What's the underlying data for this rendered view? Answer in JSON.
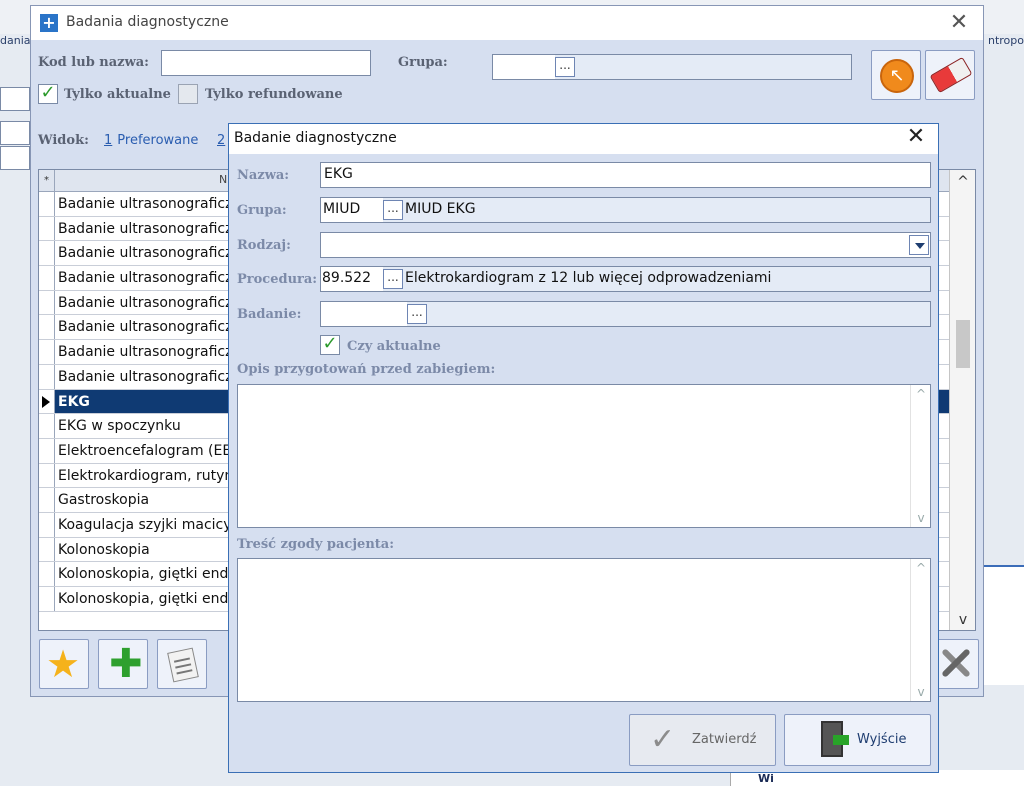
{
  "background": {
    "left_label": "dania",
    "right_label": "ntropo",
    "bottom_label": "Wi"
  },
  "outer_dialog": {
    "title": "Badania diagnostyczne",
    "kod_label": "Kod lub nazwa:",
    "kod_value": "",
    "grupa_label": "Grupa:",
    "grupa_value": "",
    "ellipsis": "...",
    "tylko_aktualne_label": "Tylko aktualne",
    "tylko_aktualne_checked": true,
    "tylko_refundowane_label": "Tylko refundowane",
    "tylko_refundowane_checked": false,
    "widok_label": "Widok:",
    "widok_opt1_num": "1",
    "widok_opt1_label": "Preferowane",
    "widok_opt2_num": "2",
    "grid_star": "*",
    "grid_column": "N",
    "rows": [
      "Badanie ultrasonograficz",
      "Badanie ultrasonograficz",
      "Badanie ultrasonograficz",
      "Badanie ultrasonograficz",
      "Badanie ultrasonograficz",
      "Badanie ultrasonograficz",
      "Badanie ultrasonograficz",
      "Badanie ultrasonograficz",
      "EKG",
      "EKG w spoczynku",
      "Elektroencefalogram (EE",
      "Elektrokardiogram, rutyn",
      "Gastroskopia",
      "Koagulacja szyjki macicy",
      "Kolonoskopia",
      "Kolonoskopia, giętki end",
      "Kolonoskopia, giętki end"
    ],
    "selected_row_index": 8,
    "scroll_up": "^",
    "scroll_down": "v"
  },
  "inner_dialog": {
    "title": "Badanie diagnostyczne",
    "nazwa_label": "Nazwa:",
    "nazwa_value": "EKG",
    "grupa_label": "Grupa:",
    "grupa_code": "MIUD",
    "grupa_name": "MIUD EKG",
    "rodzaj_label": "Rodzaj:",
    "rodzaj_value": "",
    "procedura_label": "Procedura:",
    "procedura_code": "89.522",
    "procedura_name": "Elektrokardiogram z 12 lub więcej odprowadzeniami",
    "badanie_label": "Badanie:",
    "badanie_value": "",
    "czy_aktualne_label": "Czy aktualne",
    "czy_aktualne_checked": true,
    "opis_label": "Opis przygotowań przed zabiegiem:",
    "opis_value": "",
    "tresc_label": "Treść zgody pacjenta:",
    "tresc_value": "",
    "ellipsis": "...",
    "zatwierdz_label": "Zatwierdź",
    "wyjscie_label": "Wyjście"
  },
  "icons": {
    "check": "✓",
    "close": "✕",
    "star": "★",
    "plus": "✚",
    "orange_arrow": "↖"
  },
  "colors": {
    "selected_row": "#0f3a73",
    "dialog_bg": "#d6dff0",
    "check_green": "#2c9a2c"
  }
}
